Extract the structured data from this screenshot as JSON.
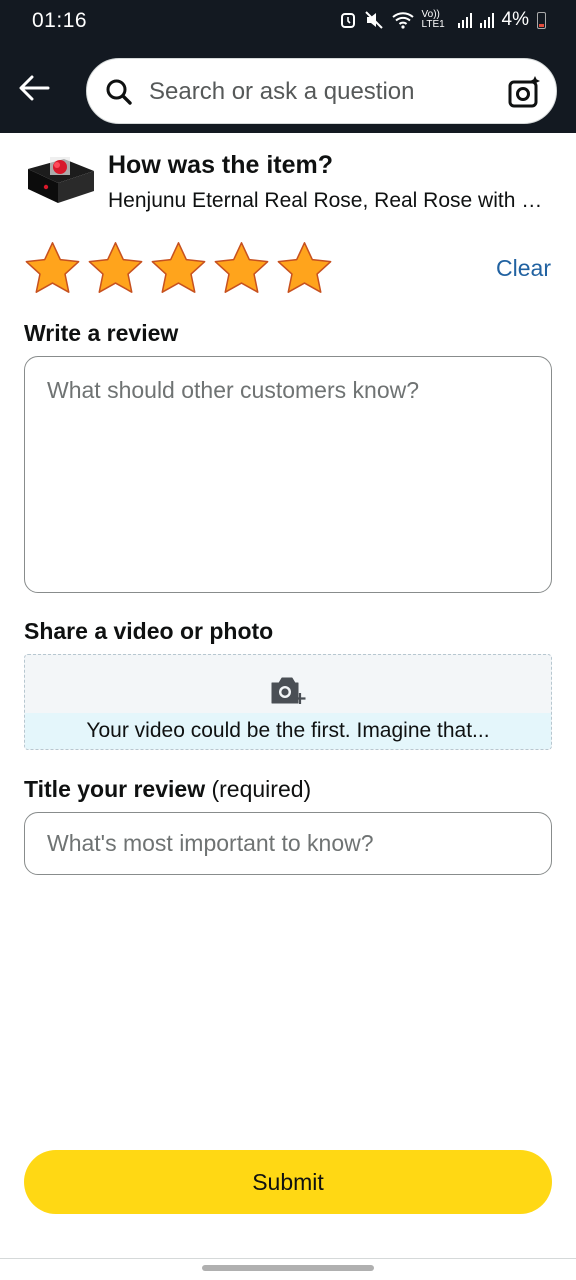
{
  "status_bar": {
    "time": "01:16",
    "network": "Vo)) LTE1",
    "battery": "4%"
  },
  "header": {
    "search_placeholder": "Search or ask a question",
    "back_icon": "arrow-left-icon",
    "lens_icon": "camera-search-icon"
  },
  "product": {
    "heading": "How was the item?",
    "name": "Henjunu Eternal Real Rose, Real Rose with Heart Necklace Gift Box"
  },
  "rating": {
    "stars_selected": 5,
    "stars_total": 5,
    "clear_label": "Clear",
    "star_color": "#ffa41c"
  },
  "review": {
    "label": "Write a review",
    "placeholder": "What should other customers know?"
  },
  "media": {
    "label": "Share a video or photo",
    "banner": "Your video could be the first. Imagine that...",
    "icon": "camera-add-icon"
  },
  "title": {
    "label": "Title your review",
    "label_suffix": "(required)",
    "placeholder": "What's most important to know?"
  },
  "submit": {
    "label": "Submit",
    "color": "#ffd814"
  },
  "colors": {
    "header_bg": "#131921",
    "link": "#2162a1"
  }
}
